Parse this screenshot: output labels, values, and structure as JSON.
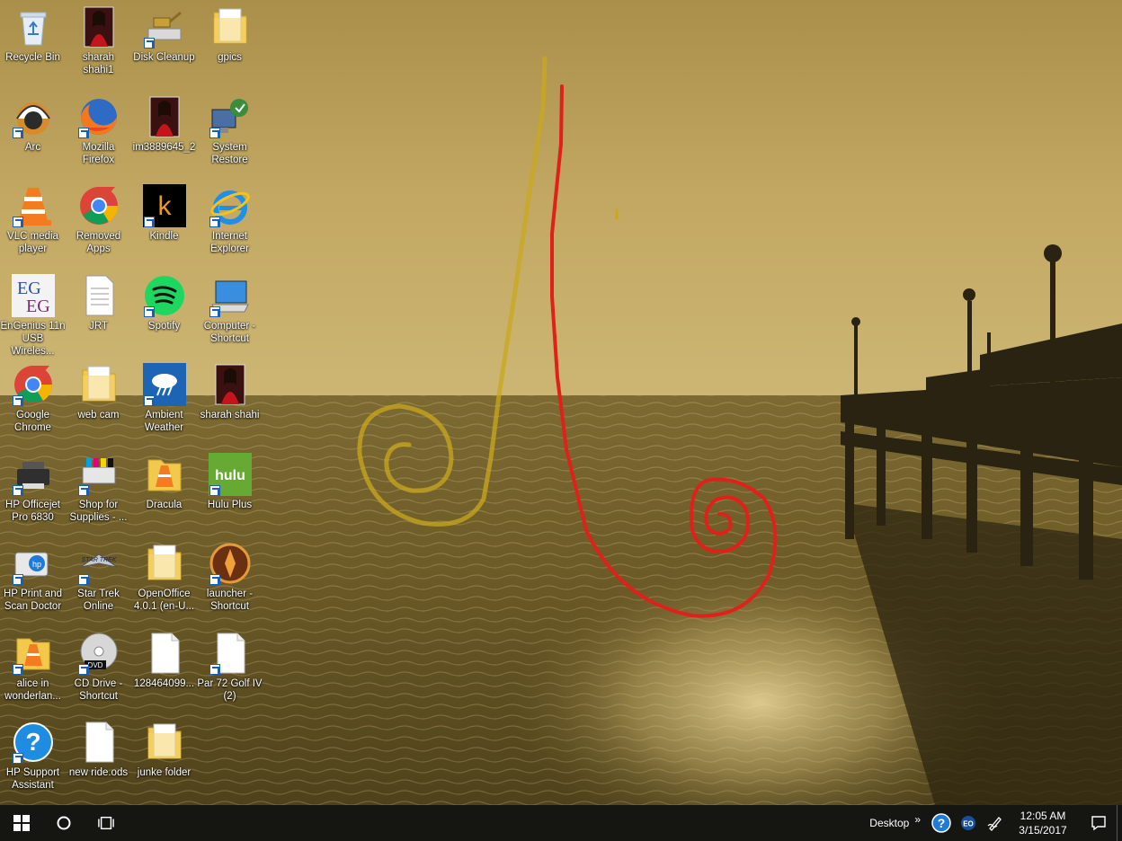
{
  "desktop": {
    "icons": [
      {
        "key": "recycle-bin",
        "label": "Recycle Bin",
        "icon": "recycle-bin-icon",
        "shortcut": false
      },
      {
        "key": "sharah-shahi1",
        "label": "sharah\nshahi1",
        "icon": "photo-icon",
        "shortcut": false
      },
      {
        "key": "disk-cleanup",
        "label": "Disk Cleanup",
        "icon": "disk-cleanup-icon",
        "shortcut": true
      },
      {
        "key": "gpics",
        "label": "gpics",
        "icon": "folder-icon",
        "shortcut": false
      },
      {
        "key": "arc",
        "label": "Arc",
        "icon": "arc-icon",
        "shortcut": true
      },
      {
        "key": "mozilla-firefox",
        "label": "Mozilla\nFirefox",
        "icon": "firefox-icon",
        "shortcut": true
      },
      {
        "key": "im3889645",
        "label": "im3889645_2",
        "icon": "photo-icon",
        "shortcut": false
      },
      {
        "key": "system-restore",
        "label": "System\nRestore",
        "icon": "system-restore-icon",
        "shortcut": true
      },
      {
        "key": "vlc",
        "label": "VLC media\nplayer",
        "icon": "vlc-icon",
        "shortcut": true
      },
      {
        "key": "removed-apps",
        "label": "Removed\nApps",
        "icon": "chrome-icon",
        "shortcut": false
      },
      {
        "key": "kindle",
        "label": "Kindle",
        "icon": "kindle-icon",
        "shortcut": true
      },
      {
        "key": "internet-explorer",
        "label": "Internet\nExplorer",
        "icon": "ie-icon",
        "shortcut": true
      },
      {
        "key": "engenius",
        "label": "EnGenius 11n\nUSB Wireles...",
        "icon": "engenius-icon",
        "shortcut": false
      },
      {
        "key": "jrt",
        "label": "JRT",
        "icon": "document-icon",
        "shortcut": false
      },
      {
        "key": "spotify",
        "label": "Spotify",
        "icon": "spotify-icon",
        "shortcut": true
      },
      {
        "key": "computer-shortcut",
        "label": "Computer -\nShortcut",
        "icon": "computer-icon",
        "shortcut": true
      },
      {
        "key": "google-chrome",
        "label": "Google\nChrome",
        "icon": "chrome-icon",
        "shortcut": true
      },
      {
        "key": "web-cam",
        "label": "web cam",
        "icon": "folder-icon",
        "shortcut": false
      },
      {
        "key": "ambient-weather",
        "label": "Ambient\nWeather",
        "icon": "weather-icon",
        "shortcut": true
      },
      {
        "key": "sharah-shahi",
        "label": "sharah shahi",
        "icon": "photo-icon",
        "shortcut": false
      },
      {
        "key": "hp-officejet",
        "label": "HP Officejet\nPro 6830",
        "icon": "printer-icon",
        "shortcut": true
      },
      {
        "key": "shop-for-supplies",
        "label": "Shop for\nSupplies - ...",
        "icon": "printer-supplies-icon",
        "shortcut": true
      },
      {
        "key": "dracula",
        "label": "Dracula",
        "icon": "vlc-folder-icon",
        "shortcut": false
      },
      {
        "key": "hulu-plus",
        "label": "Hulu Plus",
        "icon": "hulu-icon",
        "shortcut": true
      },
      {
        "key": "hp-print-scan",
        "label": "HP Print and\nScan Doctor",
        "icon": "hp-scan-icon",
        "shortcut": true
      },
      {
        "key": "star-trek-online",
        "label": "Star Trek\nOnline",
        "icon": "star-trek-icon",
        "shortcut": true
      },
      {
        "key": "openoffice",
        "label": "OpenOffice\n4.0.1 (en-U...",
        "icon": "folder-icon",
        "shortcut": false
      },
      {
        "key": "launcher-shortcut",
        "label": "launcher -\nShortcut",
        "icon": "launcher-icon",
        "shortcut": true
      },
      {
        "key": "alice-in-wonderland",
        "label": "alice in\nwonderlan...",
        "icon": "vlc-folder-icon",
        "shortcut": true
      },
      {
        "key": "cd-drive",
        "label": "CD Drive -\nShortcut",
        "icon": "dvd-icon",
        "shortcut": true
      },
      {
        "key": "file-128464099",
        "label": "128464099...",
        "icon": "blank-file-icon",
        "shortcut": false
      },
      {
        "key": "par72-golf",
        "label": "Par 72 Golf IV\n(2)",
        "icon": "blank-file-icon",
        "shortcut": true
      },
      {
        "key": "hp-support-assistant",
        "label": "HP Support\nAssistant",
        "icon": "help-icon",
        "shortcut": true
      },
      {
        "key": "new-ride",
        "label": "new ride.ods",
        "icon": "blank-file-icon",
        "shortcut": false
      },
      {
        "key": "junke-folder",
        "label": "junke folder",
        "icon": "folder-icon",
        "shortcut": false
      }
    ]
  },
  "taskbar": {
    "start_icon": "windows-logo-icon",
    "search_icon": "cortana-circle-icon",
    "task_view_icon": "task-view-icon",
    "desktop_toolbar_label": "Desktop",
    "overflow_chevron": "»",
    "tray_icons": [
      "help-icon",
      "eo-icon",
      "pen-icon"
    ],
    "eo_label": "EO",
    "clock_time": "12:05 AM",
    "clock_date": "3/15/2017",
    "notification_icon": "action-center-icon"
  },
  "colors": {
    "taskbar_bg": "#151612",
    "sepia_sky": "#b89d53",
    "sepia_water": "#6e5c28",
    "ink_red": "#e0201b",
    "ink_yellow": "#c9a81c"
  }
}
